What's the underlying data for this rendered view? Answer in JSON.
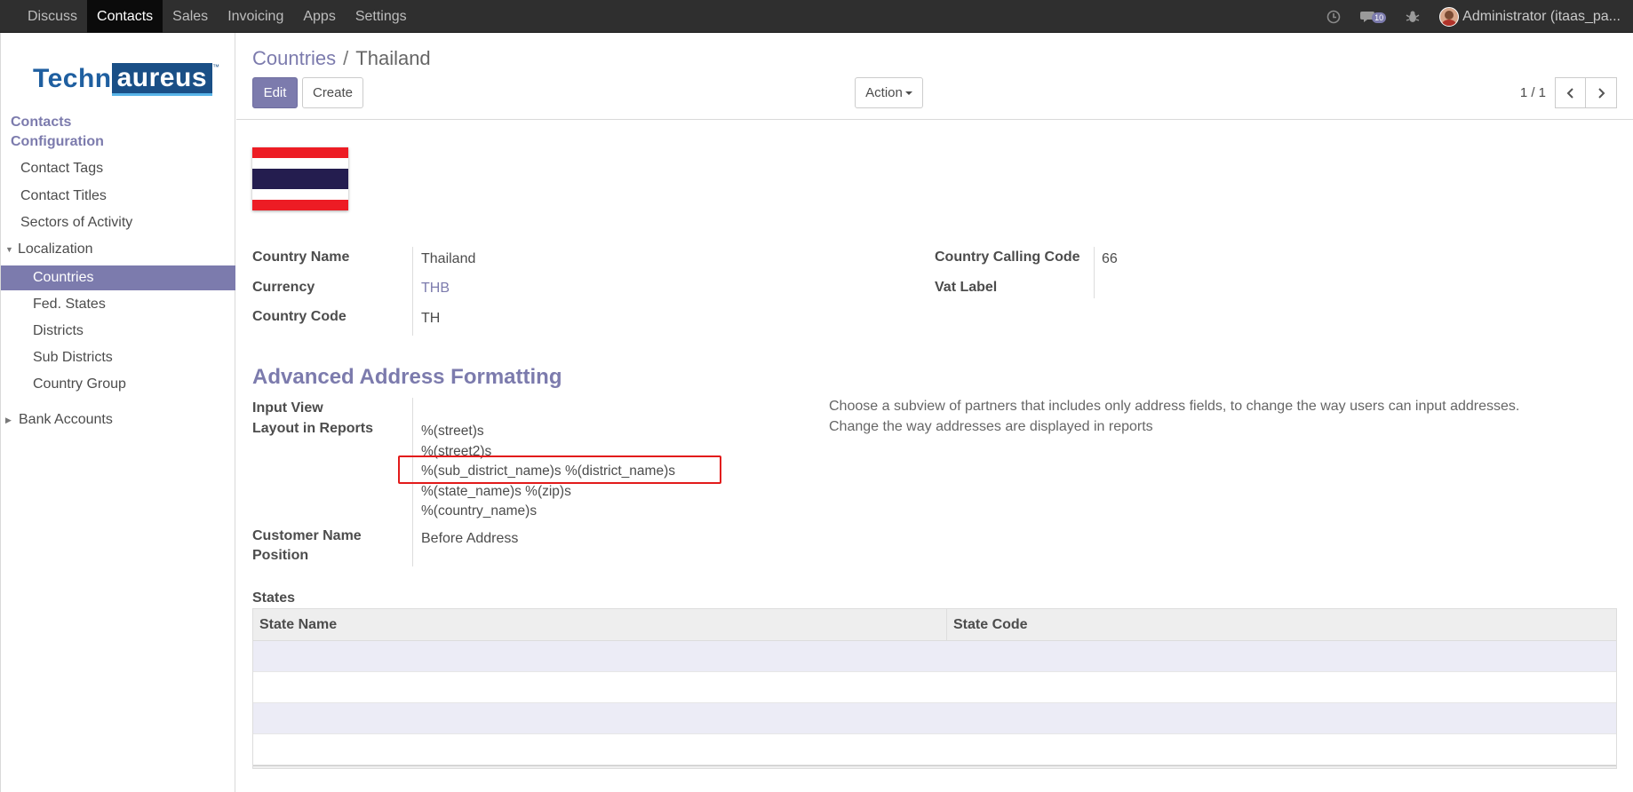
{
  "topbar": {
    "menu": [
      "Discuss",
      "Contacts",
      "Sales",
      "Invoicing",
      "Apps",
      "Settings"
    ],
    "active_index": 1,
    "message_count": "10",
    "user_label": "Administrator (itaas_pa..."
  },
  "sidebar": {
    "logo": {
      "part1": "Techn",
      "part2": "aureus",
      "tm": "™"
    },
    "title_contacts": "Contacts",
    "title_configuration": "Configuration",
    "items": {
      "contact_tags": "Contact Tags",
      "contact_titles": "Contact Titles",
      "sectors": "Sectors of Activity",
      "localization": "Localization",
      "countries": "Countries",
      "fed_states": "Fed. States",
      "districts": "Districts",
      "sub_districts": "Sub Districts",
      "country_group": "Country Group",
      "bank_accounts": "Bank Accounts"
    }
  },
  "control": {
    "breadcrumb_parent": "Countries",
    "breadcrumb_separator": "/",
    "breadcrumb_current": "Thailand",
    "edit_label": "Edit",
    "create_label": "Create",
    "action_label": "Action",
    "pager_value": "1 / 1"
  },
  "form": {
    "flag_colors": [
      "#ed1c24",
      "#ffffff",
      "#241d4f",
      "#ffffff",
      "#ed1c24"
    ],
    "country_name_label": "Country Name",
    "country_name_value": "Thailand",
    "currency_label": "Currency",
    "currency_value": "THB",
    "country_code_label": "Country Code",
    "country_code_value": "TH",
    "calling_code_label": "Country Calling Code",
    "calling_code_value": "66",
    "vat_label_label": "Vat Label",
    "vat_label_value": "",
    "section_title": "Advanced Address Formatting",
    "input_view_label": "Input View",
    "layout_reports_label": "Layout in Reports",
    "layout_lines": [
      "%(street)s",
      "%(street2)s",
      "%(sub_district_name)s %(district_name)s",
      "%(state_name)s %(zip)s",
      "%(country_name)s"
    ],
    "input_view_help": "Choose a subview of partners that includes only address fields, to change the way users can input addresses.",
    "layout_help": "Change the way addresses are displayed in reports",
    "customer_name_label_1": "Customer Name",
    "customer_name_label_2": "Position",
    "customer_name_value": "Before Address",
    "highlight_color": "#e21b1b"
  },
  "states": {
    "label": "States",
    "columns": [
      "State Name",
      "State Code"
    ],
    "rows": []
  },
  "colors": {
    "accent": "#7c7bad",
    "topbar": "#2f2f2f"
  }
}
